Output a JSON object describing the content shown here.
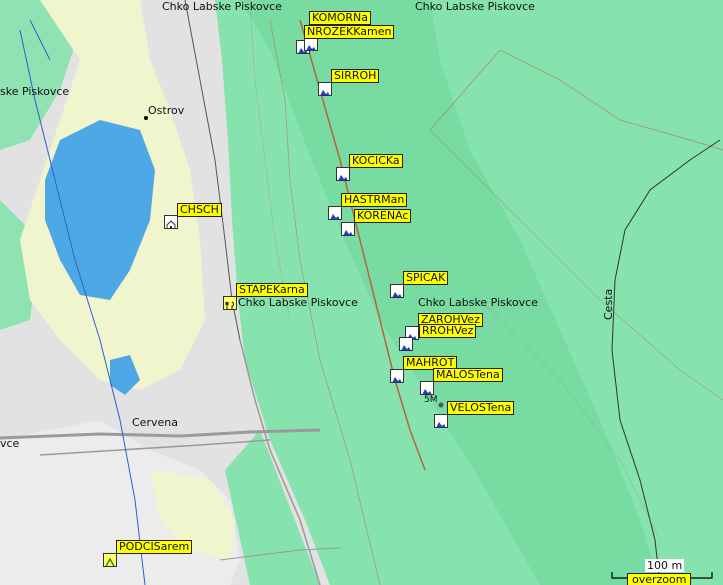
{
  "map": {
    "place_labels": {
      "chko_top_left": "Chko Labske Piskovce",
      "chko_top_right": "Chko Labske Piskovce",
      "piskovce_left": "ske Piskovce",
      "ostrov": "Ostrov",
      "chko_mid": "Chko Labske Piskovce",
      "chko_mid_right": "Chko Labske Piskovce",
      "cervena": "Cervena",
      "vce_left": "vce",
      "cesta": "Cesta",
      "elevation_mark": "5M"
    },
    "pois": [
      {
        "id": "komorna",
        "label": "KOMORNa",
        "icon": "peak-icon"
      },
      {
        "id": "nrozekkamen",
        "label": "NROZEKKamen",
        "icon": "peak-icon"
      },
      {
        "id": "sirroh",
        "label": "SIRROH",
        "icon": "peak-icon"
      },
      {
        "id": "kocicka",
        "label": "KOCICKa",
        "icon": "peak-icon"
      },
      {
        "id": "hastrman",
        "label": "HASTRMan",
        "icon": "peak-icon"
      },
      {
        "id": "korenac",
        "label": "KORENAc",
        "icon": "peak-icon"
      },
      {
        "id": "chsch",
        "label": "CHSCH",
        "icon": "hut-icon"
      },
      {
        "id": "stapekarna",
        "label": "STAPEKarna",
        "icon": "restaurant-icon"
      },
      {
        "id": "spicak",
        "label": "SPICAK",
        "icon": "peak-icon"
      },
      {
        "id": "zarohvez",
        "label": "ZAROHVez",
        "icon": "peak-icon"
      },
      {
        "id": "srohvez",
        "label": "RROHVez",
        "icon": "peak-icon"
      },
      {
        "id": "mahrot",
        "label": "MAHROT",
        "icon": "peak-icon"
      },
      {
        "id": "malostena",
        "label": "MALOSTena",
        "icon": "peak-icon"
      },
      {
        "id": "velostena",
        "label": "VELOSTena",
        "icon": "peak-icon"
      },
      {
        "id": "podcisarem",
        "label": "PODCISarem",
        "icon": "campsite-icon"
      }
    ],
    "scale": {
      "label": "100 m"
    },
    "overzoom": "overzoom",
    "colors": {
      "forest": "#80e0a8",
      "forest_dark": "#5fcf8a",
      "meadow": "#f3f6cf",
      "water": "#4fa8e6",
      "urban": "#dcdcdc",
      "label_bg": "#ffff00",
      "peak_blue": "#1f3fd0"
    }
  }
}
